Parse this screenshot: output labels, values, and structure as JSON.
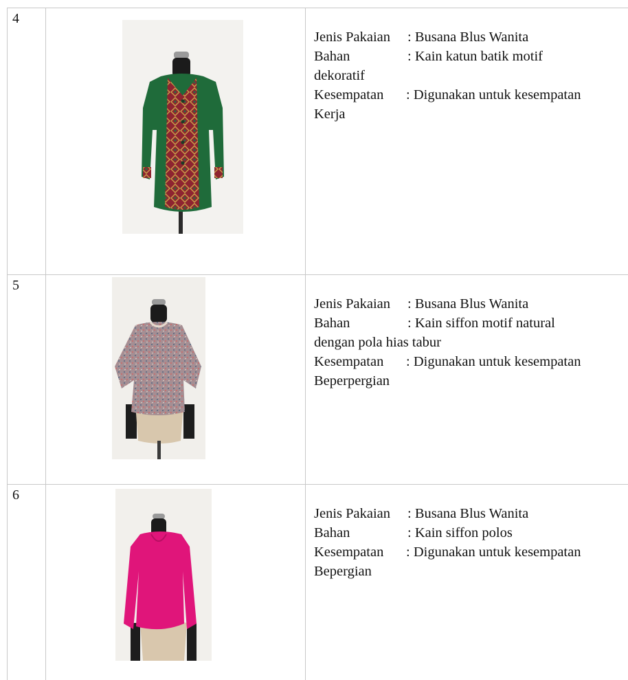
{
  "rows": [
    {
      "number": "4",
      "garment_colors": {
        "body": "#1f6b3a",
        "panel": "#8e2430",
        "accent": "#c9a34a"
      },
      "description": {
        "jenis_label": "Jenis Pakaian",
        "jenis_value": ": Busana Blus Wanita",
        "bahan_label": "Bahan",
        "bahan_value": ": Kain katun batik motif",
        "bahan_cont": "dekoratif",
        "kesempatan_label": "Kesempatan",
        "kesempatan_value": ": Digunakan untuk kesempatan",
        "kesempatan_cont": "Kerja"
      }
    },
    {
      "number": "5",
      "garment_colors": {
        "body": "#a58e93",
        "speckle": "#5e6f86",
        "accent": "#c86e6e"
      },
      "description": {
        "jenis_label": "Jenis Pakaian",
        "jenis_value": ": Busana Blus Wanita",
        "bahan_label": "Bahan",
        "bahan_value": ": Kain siffon motif natural",
        "bahan_cont": "dengan pola hias tabur",
        "kesempatan_label": "Kesempatan",
        "kesempatan_value": ": Digunakan untuk kesempatan",
        "kesempatan_cont": "Beperpergian"
      }
    },
    {
      "number": "6",
      "garment_colors": {
        "body": "#e0157a"
      },
      "description": {
        "jenis_label": "Jenis Pakaian",
        "jenis_value": ": Busana Blus Wanita",
        "bahan_label": "Bahan",
        "bahan_value": ": Kain siffon polos",
        "kesempatan_label": "Kesempatan",
        "kesempatan_value": ": Digunakan untuk kesempatan",
        "kesempatan_cont": "Bepergian"
      }
    }
  ]
}
